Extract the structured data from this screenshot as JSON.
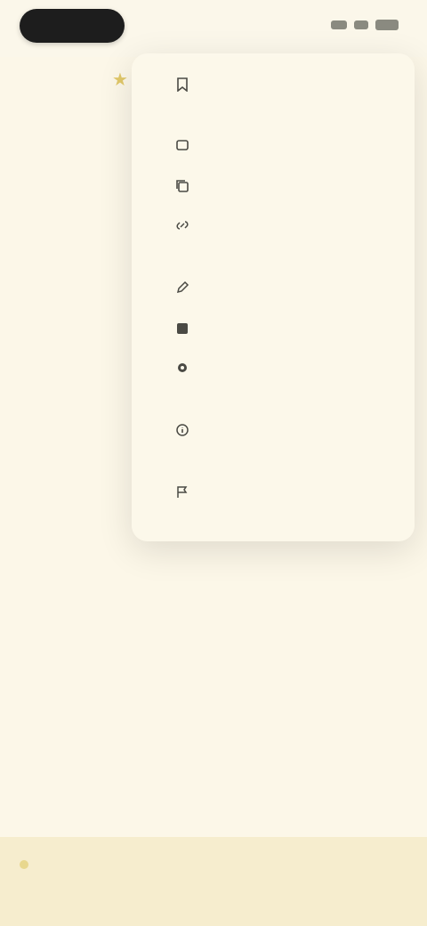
{
  "status_bar": {
    "time": "",
    "icons": [
      "signal-icon",
      "wifi-icon",
      "battery-icon"
    ]
  },
  "background": {
    "star_icon": "star-icon",
    "left_items": [
      "",
      "",
      "",
      "",
      "",
      "",
      "",
      ""
    ]
  },
  "menu": {
    "items": [
      {
        "icon": "bookmark-icon",
        "label": ""
      },
      {
        "icon": "share-icon",
        "label": ""
      },
      {
        "icon": "copy-icon",
        "label": ""
      },
      {
        "icon": "link-icon",
        "label": ""
      },
      {
        "icon": "edit-icon",
        "label": ""
      },
      {
        "icon": "text-icon",
        "label": ""
      },
      {
        "icon": "settings-icon",
        "label": ""
      },
      {
        "icon": "info-icon",
        "label": ""
      },
      {
        "icon": "report-icon",
        "label": ""
      }
    ]
  },
  "bottom_bar": {
    "left_text": "",
    "right_text": ""
  },
  "colors": {
    "background": "#fcf7e8",
    "menu_bg": "#fcf8ea",
    "accent": "#e1c86a",
    "bottom_bar": "#f6edce"
  }
}
